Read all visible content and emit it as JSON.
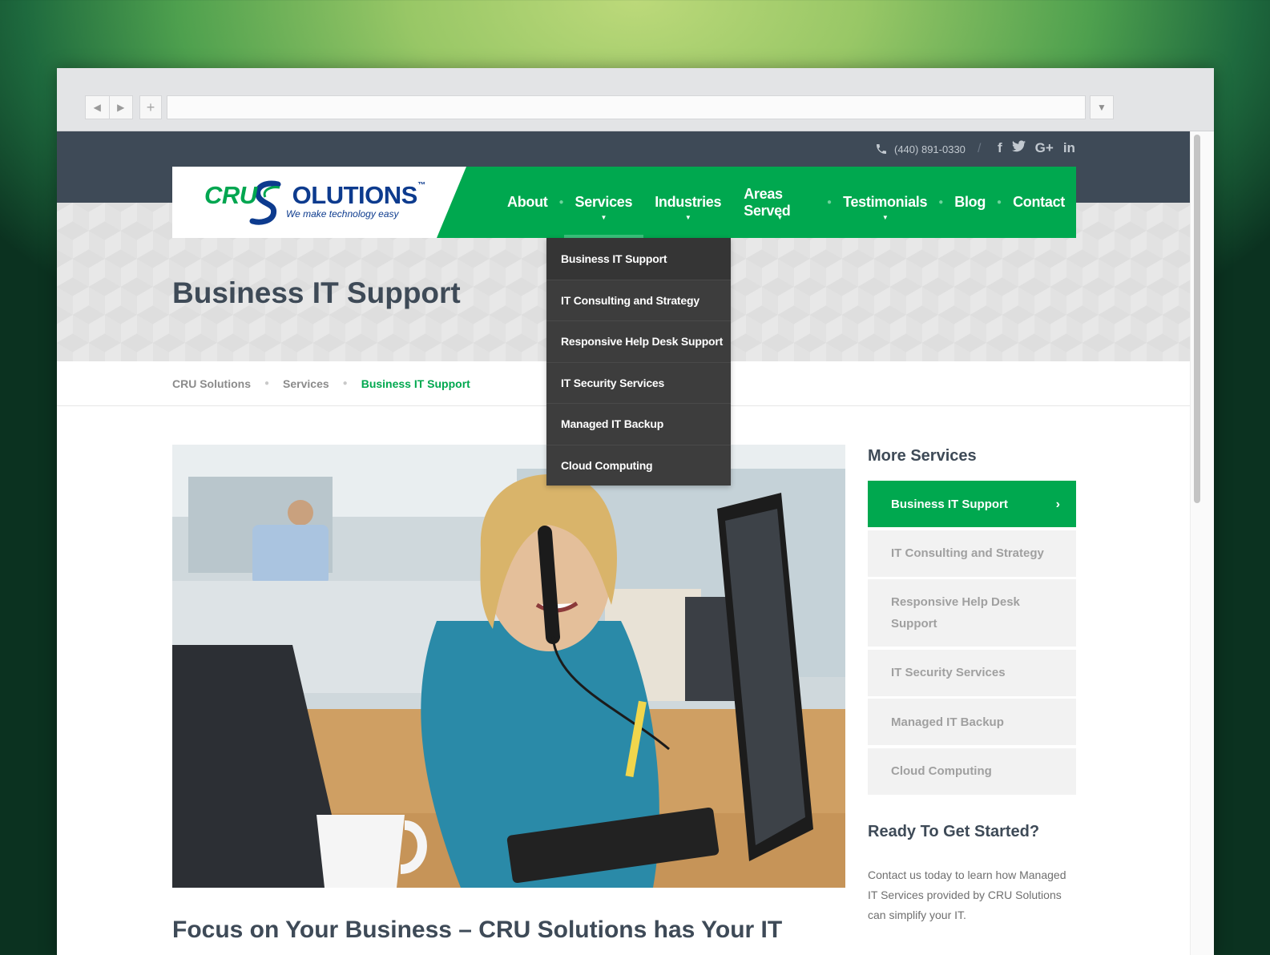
{
  "topbar": {
    "phone": "(440) 891-0330",
    "separator": "/",
    "social": [
      "f",
      "t",
      "G+",
      "in"
    ]
  },
  "logo": {
    "cru": "CRU",
    "solutions": "OLUTIONS",
    "tm": "™",
    "tagline": "We make technology easy"
  },
  "nav": {
    "items": [
      {
        "label": "About",
        "has_dropdown": false
      },
      {
        "label": "Services",
        "has_dropdown": true,
        "active": true
      },
      {
        "label": "Industries",
        "has_dropdown": true
      },
      {
        "label": "Areas Served",
        "has_dropdown": true
      },
      {
        "label": "Testimonials",
        "has_dropdown": true
      },
      {
        "label": "Blog",
        "has_dropdown": false
      },
      {
        "label": "Contact",
        "has_dropdown": false
      }
    ]
  },
  "dropdown": {
    "items": [
      "Business IT Support",
      "IT Consulting and Strategy",
      "Responsive Help Desk Support",
      "IT Security Services",
      "Managed IT Backup",
      "Cloud Computing"
    ]
  },
  "page": {
    "title": "Business IT Support",
    "subheading": "Focus on Your Business – CRU Solutions has Your IT"
  },
  "breadcrumbs": [
    "CRU Solutions",
    "Services",
    "Business IT Support"
  ],
  "sidebar": {
    "heading": "More Services",
    "items": [
      "Business IT Support",
      "IT Consulting and Strategy",
      "Responsive Help Desk Support",
      "IT Security Services",
      "Managed IT Backup",
      "Cloud Computing"
    ],
    "cta_heading": "Ready To Get Started?",
    "cta_text": "Contact us today to learn how Managed IT Services provided by CRU Solutions can simplify your IT."
  },
  "colors": {
    "brand_green": "#00a84f",
    "brand_navy": "#3e4a57",
    "dropdown_bg": "#3a3a3a"
  },
  "icons": {
    "phone": "phone-icon",
    "back": "back-arrow-icon",
    "forward": "forward-arrow-icon",
    "new_tab": "plus-icon",
    "menu": "dropdown-triangle-icon"
  }
}
